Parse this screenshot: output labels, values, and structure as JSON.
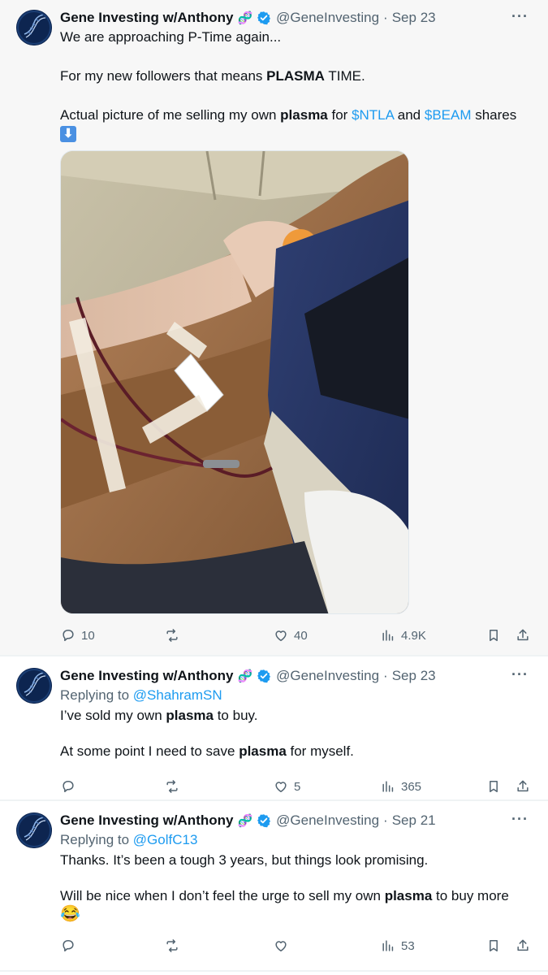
{
  "colors": {
    "accent": "#1d9bf0",
    "muted": "#536471",
    "text": "#0f1419",
    "verified": "#1d9bf0"
  },
  "tweets": [
    {
      "name": "Gene Investing w/Anthony",
      "handle": "@GeneInvesting",
      "date": "Sep 23",
      "line1": "We are approaching P-Time again...",
      "line2_pre": "For my new followers that means ",
      "line2_bold": "PLASMA",
      "line2_post": " TIME.",
      "line3_pre": "Actual picture of me selling my own ",
      "line3_bold": "plasma",
      "line3_mid1": " for ",
      "cashtag1": "$NTLA",
      "line3_mid2": " and ",
      "cashtag2": "$BEAM",
      "line3_post": " shares",
      "arrow_emoji": "⬇",
      "replies": "10",
      "likes": "40",
      "views": "4.9K"
    },
    {
      "name": "Gene Investing w/Anthony",
      "handle": "@GeneInvesting",
      "date": "Sep 23",
      "replying_prefix": "Replying to ",
      "replying_to": "@ShahramSN",
      "line1_pre": "I’ve sold my own ",
      "line1_bold": "plasma",
      "line1_post": " to buy.",
      "line2_pre": "At some point I need to save ",
      "line2_bold": "plasma",
      "line2_post": " for myself.",
      "likes": "5",
      "views": "365"
    },
    {
      "name": "Gene Investing w/Anthony",
      "handle": "@GeneInvesting",
      "date": "Sep 21",
      "replying_prefix": "Replying to ",
      "replying_to": "@GolfC13",
      "line1": "Thanks. It’s been a tough 3 years, but things look promising.",
      "line2_pre": "Will be nice when I don’t feel the urge to sell my own ",
      "line2_bold": "plasma",
      "line2_post": " to buy more",
      "laugh_emoji": "😂",
      "views": "53"
    }
  ],
  "icons": {
    "reply": "reply-icon",
    "retweet": "retweet-icon",
    "like": "heart-icon",
    "views": "views-icon",
    "bookmark": "bookmark-icon",
    "share": "share-icon",
    "more": "more-icon",
    "verified": "verified-badge-icon",
    "dna": "dna-emoji-icon"
  }
}
